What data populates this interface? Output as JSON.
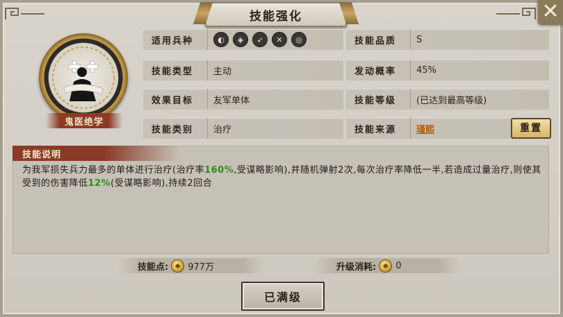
{
  "window": {
    "title": "技能强化"
  },
  "skill": {
    "name": "鬼医绝学"
  },
  "info_left": [
    {
      "label": "适用兵种",
      "value": "",
      "unit_icons": [
        "shield-unit-icon",
        "archer-unit-icon",
        "bow-unit-icon",
        "spear-unit-icon",
        "cavalry-unit-icon"
      ]
    },
    {
      "label": "技能类型",
      "value": "主动"
    },
    {
      "label": "效果目标",
      "value": "友军单体"
    },
    {
      "label": "技能类别",
      "value": "治疗"
    }
  ],
  "info_right": [
    {
      "label": "技能品质",
      "value": "S"
    },
    {
      "label": "发动概率",
      "value": "45%"
    },
    {
      "label": "技能等级",
      "value": "(已达到最高等级)"
    },
    {
      "label": "技能来源",
      "value": "瑾熙"
    }
  ],
  "reset_button": "重置",
  "description": {
    "title": "技能说明",
    "parts": [
      {
        "t": "为我军损失兵力最多的单体进行治疗(治疗率",
        "hl": false
      },
      {
        "t": "160%",
        "hl": true
      },
      {
        "t": ",受谋略影响),并随机弹射2次,每次治疗率降低一半,若造成过量治疗,则使其受到的伤害降低",
        "hl": false
      },
      {
        "t": "12%",
        "hl": true
      },
      {
        "t": "(受谋略影响),持续2回合",
        "hl": false
      }
    ]
  },
  "skill_points": {
    "label": "技能点:",
    "value": "977万"
  },
  "upgrade_cost": {
    "label": "升级消耗:",
    "value": "0"
  },
  "max_button": "已满级",
  "colors": {
    "highlight": "#2e8a1f",
    "link": "#b35a12",
    "plate": "#8a3a26"
  }
}
